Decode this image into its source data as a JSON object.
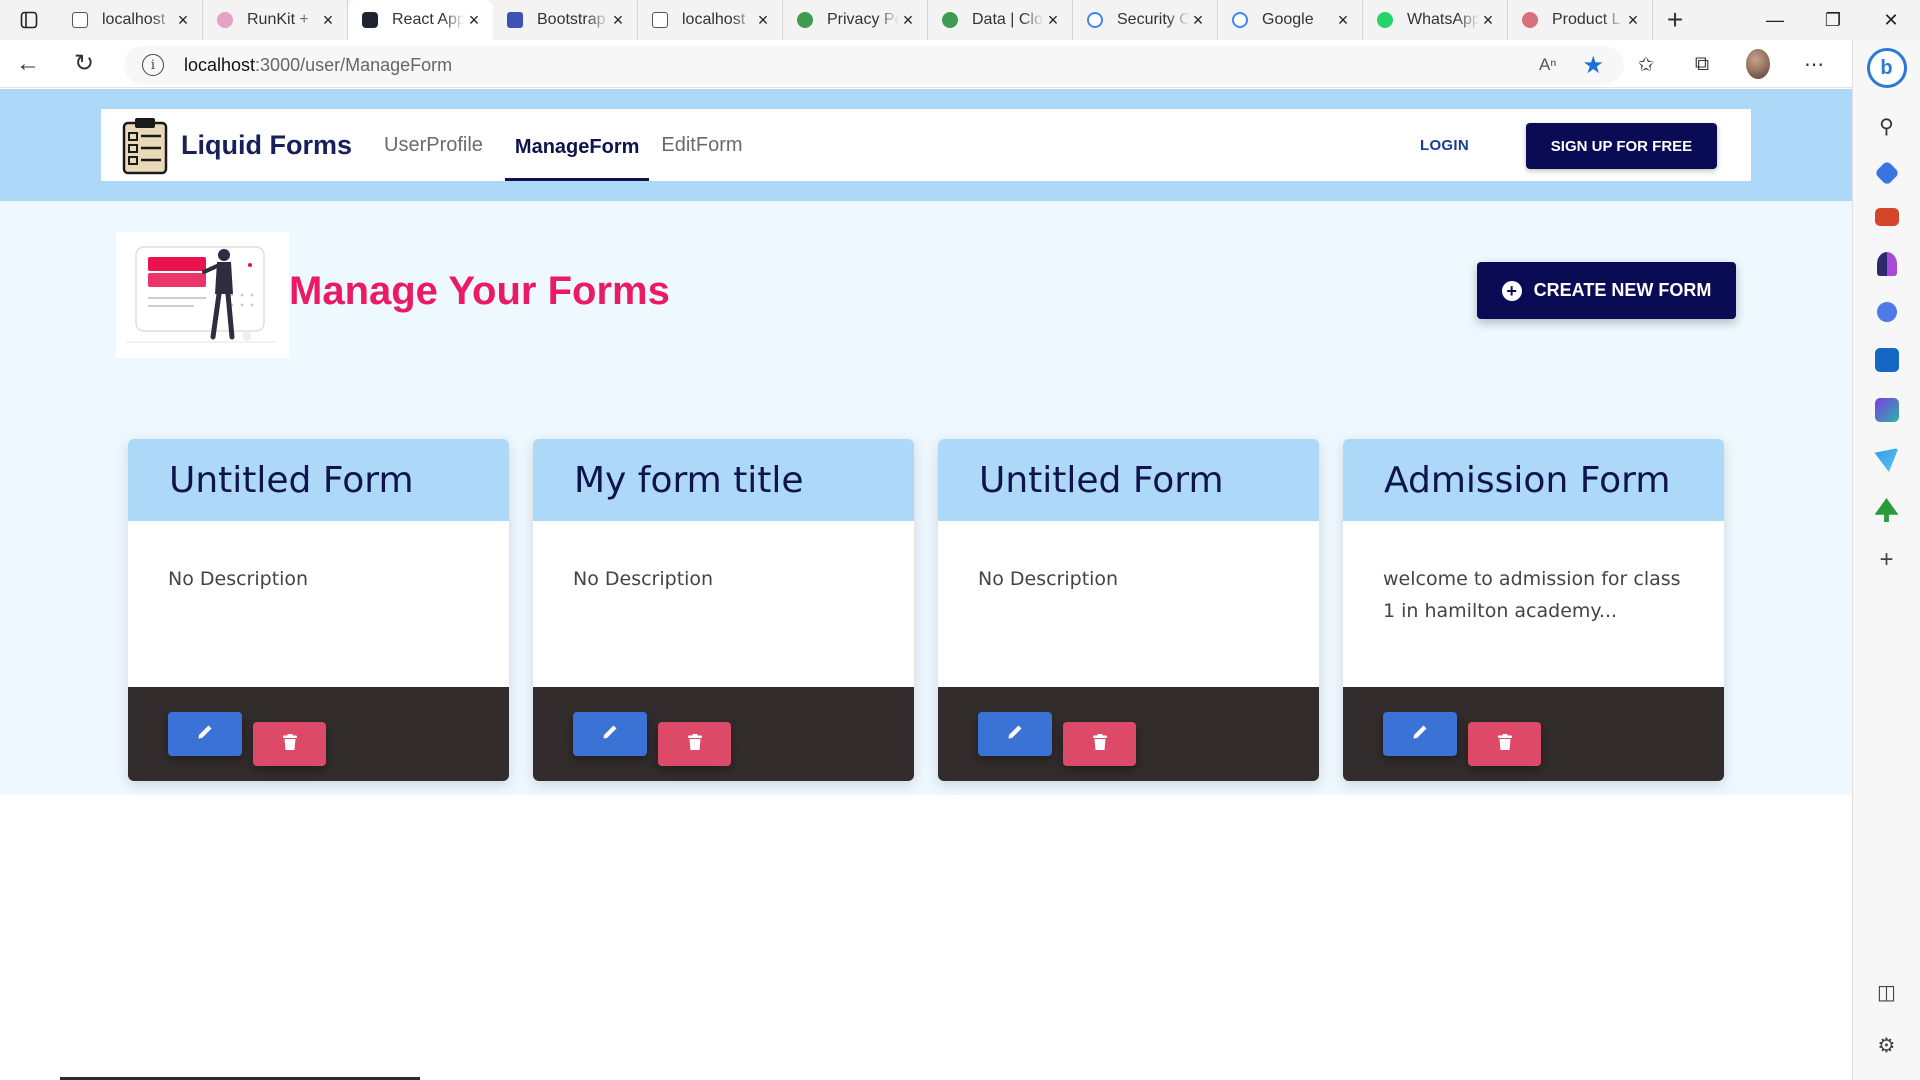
{
  "browser": {
    "tabs": [
      {
        "label": "localhost",
        "icon": "page-icon",
        "active": false
      },
      {
        "label": "RunKit +",
        "icon": "runkit-icon",
        "active": false
      },
      {
        "label": "React App",
        "icon": "react-icon",
        "active": true
      },
      {
        "label": "Bootstrap",
        "icon": "mdb-icon",
        "active": false
      },
      {
        "label": "localhost",
        "icon": "page-icon",
        "active": false
      },
      {
        "label": "Privacy Po",
        "icon": "mongodb-icon",
        "active": false
      },
      {
        "label": "Data | Clo",
        "icon": "mongodb-icon",
        "active": false
      },
      {
        "label": "Security C",
        "icon": "google-icon",
        "active": false
      },
      {
        "label": "Google",
        "icon": "google-icon",
        "active": false
      },
      {
        "label": "WhatsApp",
        "icon": "whatsapp-icon",
        "active": false
      },
      {
        "label": "Product L",
        "icon": "brain-icon",
        "active": false
      }
    ],
    "url_host": "localhost",
    "url_path": ":3000/user/ManageForm"
  },
  "app": {
    "brand": "Liquid Forms",
    "nav": {
      "user_profile": "UserProfile",
      "manage_form": "ManageForm",
      "edit_form": "EditForm"
    },
    "login": "LOGIN",
    "signup": "SIGN UP FOR FREE"
  },
  "page": {
    "title": "Manage Your Forms",
    "create_button": "CREATE NEW FORM"
  },
  "forms": [
    {
      "title": "Untitled Form",
      "description": "No Description"
    },
    {
      "title": "My form title",
      "description": "No Description"
    },
    {
      "title": "Untitled Form",
      "description": "No Description"
    },
    {
      "title": "Admission Form",
      "description": "welcome to admission for class 1 in hamilton academy..."
    }
  ],
  "colors": {
    "navy": "#0a0b55",
    "accent_pink": "#ea1a63",
    "light_blue": "#aed8f7",
    "edit_blue": "#3a72d6",
    "delete_red": "#dc4a68",
    "card_footer": "#332c2c"
  }
}
